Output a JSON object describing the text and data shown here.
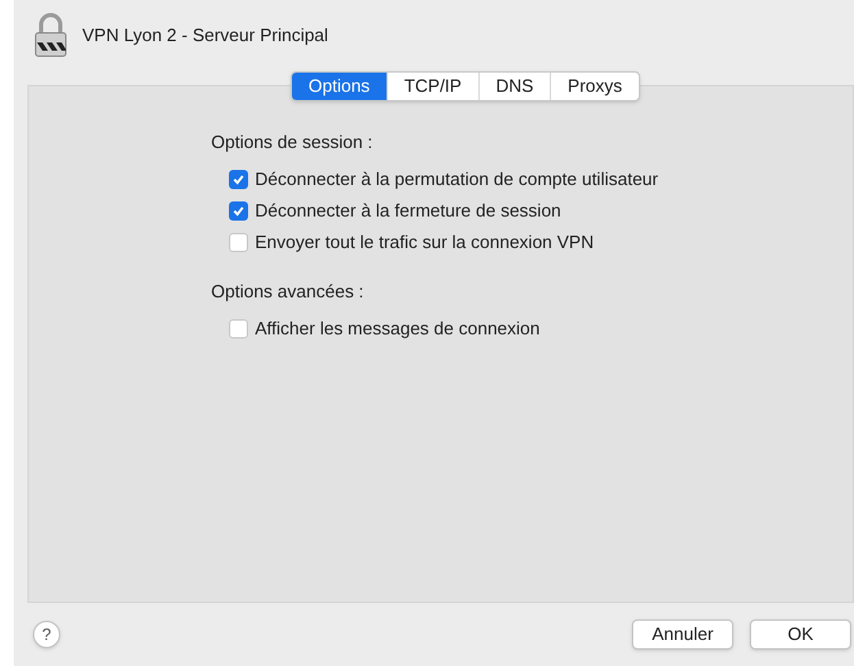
{
  "window": {
    "title": "VPN Lyon 2 - Serveur Principal"
  },
  "tabs": [
    {
      "label": "Options",
      "selected": true
    },
    {
      "label": "TCP/IP",
      "selected": false
    },
    {
      "label": "DNS",
      "selected": false
    },
    {
      "label": "Proxys",
      "selected": false
    }
  ],
  "sections": [
    {
      "heading": "Options de session :",
      "options": [
        {
          "label": "Déconnecter à la permutation de compte utilisateur",
          "checked": true
        },
        {
          "label": "Déconnecter à la fermeture de session",
          "checked": true
        },
        {
          "label": "Envoyer tout le trafic sur la connexion VPN",
          "checked": false
        }
      ]
    },
    {
      "heading": "Options avancées :",
      "options": [
        {
          "label": "Afficher les messages de connexion",
          "checked": false
        }
      ]
    }
  ],
  "help": {
    "label": "?"
  },
  "buttons": [
    "Annuler",
    "OK"
  ]
}
